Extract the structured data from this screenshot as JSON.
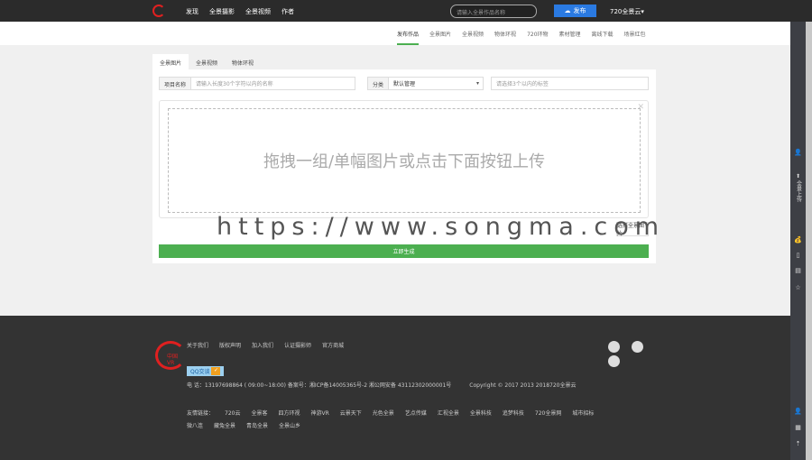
{
  "header": {
    "nav": [
      "发现",
      "全景摄影",
      "全景视频",
      "作者"
    ],
    "search_placeholder": "请输入全景作品名称",
    "publish": "发布",
    "account": "720全景云▾"
  },
  "subnav": [
    "发布作品",
    "全景图片",
    "全景视频",
    "物体环视",
    "720环物",
    "素材管理",
    "离线下载",
    "场景红包"
  ],
  "tabs": [
    "全景图片",
    "全景视频",
    "物体环视"
  ],
  "form": {
    "name_label": "项目名称",
    "name_placeholder": "请输入长度30个字符以内的名称",
    "category_label": "分类",
    "category_value": "默认管理",
    "tags_placeholder": "请选择3个以内的标签"
  },
  "upload": {
    "hint": "拖拽一组/单幅图片或点击下面按钮上传",
    "pick": "选择全景图片",
    "submit": "立即生成"
  },
  "watermark": "https://www.songma.com",
  "footer": {
    "logo_text": "中国VR",
    "links": [
      "关于我们",
      "版权声明",
      "加入我们",
      "认证摄影师",
      "官方商城"
    ],
    "qq": "QQ交谈",
    "contact": "电 话：13197698864 ( 09:00~18:00) 备案号：湘ICP备14005365号-2 湘公网安备 43112302000001号",
    "copyright": "Copyright © 2017 2013 2018720全景云",
    "friends_label": "友情链接：",
    "friends": [
      "720云",
      "全景客",
      "四方环视",
      "神游VR",
      "云景天下",
      "光色全景",
      "艺点传媒",
      "汇视全景",
      "全景科技",
      "追梦科技",
      "720全景网",
      "城市招标"
    ],
    "friends2": [
      "微八连",
      "藏兔全景",
      "青岛全景",
      "全景山乡"
    ]
  },
  "sidebar": {
    "upload_label": "全景上传"
  }
}
